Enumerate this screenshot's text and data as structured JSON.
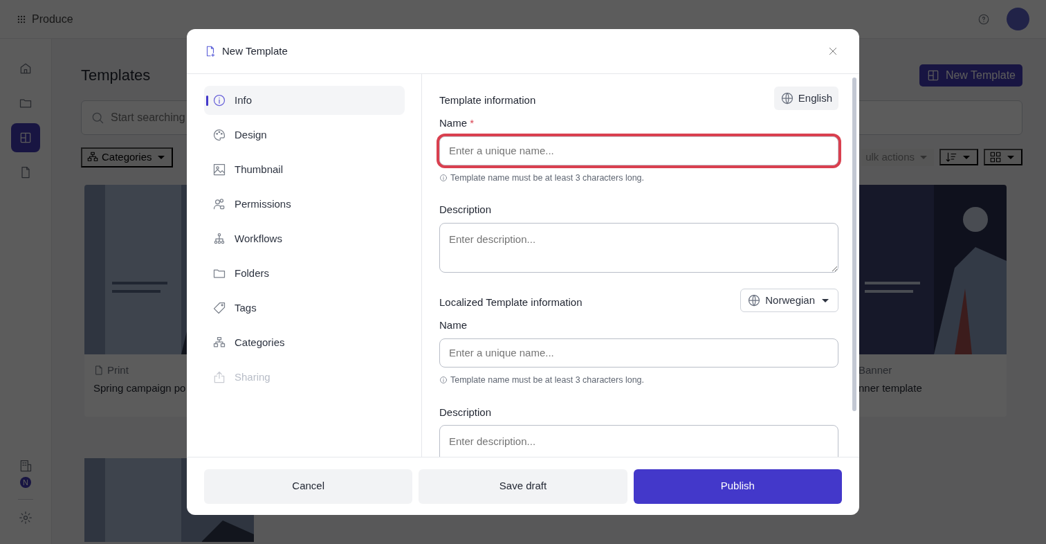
{
  "top_bar": {
    "app_name": "Produce"
  },
  "rail": {
    "items": [
      {
        "kind": "home",
        "selected": false
      },
      {
        "kind": "folder",
        "selected": false
      },
      {
        "kind": "layout",
        "selected": true
      },
      {
        "kind": "document",
        "selected": false
      }
    ],
    "badge": "N"
  },
  "page": {
    "title": "Templates",
    "new_button": "New Template",
    "search": {
      "placeholder": "Start searching"
    },
    "filters": [
      "Categories"
    ],
    "bulk_actions": "ulk actions"
  },
  "cards": [
    {
      "kind": "card",
      "type": "Print",
      "title": "Spring campaign po"
    },
    {
      "kind": "card",
      "type": "Banner",
      "title": "nner template"
    },
    {
      "kind": "picture"
    }
  ],
  "modal": {
    "title": "New Template",
    "nav": [
      {
        "label": "Info",
        "selected": true,
        "disabled": false
      },
      {
        "label": "Design",
        "selected": false,
        "disabled": false
      },
      {
        "label": "Thumbnail",
        "selected": false,
        "disabled": false
      },
      {
        "label": "Permissions",
        "selected": false,
        "disabled": false
      },
      {
        "label": "Workflows",
        "selected": false,
        "disabled": false
      },
      {
        "label": "Folders",
        "selected": false,
        "disabled": false
      },
      {
        "label": "Tags",
        "selected": false,
        "disabled": false
      },
      {
        "label": "Categories",
        "selected": false,
        "disabled": false
      },
      {
        "label": "Sharing",
        "selected": false,
        "disabled": true
      }
    ],
    "sections": [
      {
        "title": "Template information",
        "language": {
          "label": "English",
          "dropdown": false
        },
        "fields": [
          {
            "kind": "input",
            "label": "Name",
            "required_mark": "*",
            "placeholder": "Enter a unique name...",
            "error": true,
            "hint": "Template name must be at least 3 characters long."
          },
          {
            "kind": "textarea",
            "label": "Description",
            "placeholder": "Enter description...",
            "error": false
          }
        ]
      },
      {
        "title": "Localized Template information",
        "language": {
          "label": "Norwegian",
          "dropdown": true
        },
        "fields": [
          {
            "kind": "input",
            "label": "Name",
            "placeholder": "Enter a unique name...",
            "error": false,
            "hint": "Template name must be at least 3 characters long."
          },
          {
            "kind": "textarea",
            "label": "Description",
            "placeholder": "Enter description...",
            "error": false
          }
        ]
      }
    ],
    "buttons": [
      {
        "label": "Cancel",
        "kind": "secondary"
      },
      {
        "label": "Save draft",
        "kind": "secondary"
      },
      {
        "label": "Publish",
        "kind": "primary"
      }
    ]
  }
}
